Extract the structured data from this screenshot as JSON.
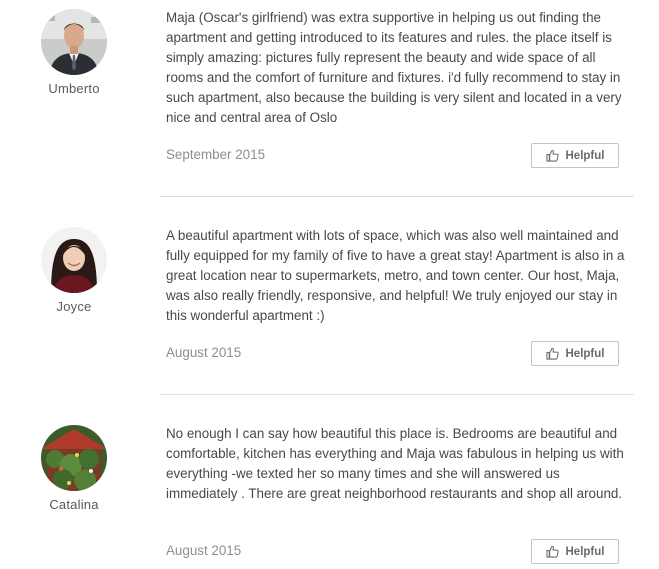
{
  "reviews": [
    {
      "reviewer": "Umberto",
      "text": "Maja (Oscar's girlfriend) was extra supportive in helping us out finding the apartment and getting introduced to its features and rules. the place itself is simply amazing: pictures fully represent the beauty and wide space of all rooms and the comfort of furniture and fixtures. i'd fully recommend to stay in such apartment, also because the building is very silent and located in a very nice and central area of Oslo",
      "date": "September 2015",
      "helpful_label": "Helpful"
    },
    {
      "reviewer": "Joyce",
      "text": "A beautiful apartment with lots of space, which was also well maintained and fully equipped for my family of five to have a great stay! Apartment is also in a great location near to supermarkets, metro, and town center. Our host, Maja, was also really friendly, responsive, and helpful! We truly enjoyed our stay in this wonderful apartment :)",
      "date": "August 2015",
      "helpful_label": "Helpful"
    },
    {
      "reviewer": "Catalina",
      "text": "No enough I can say how beautiful this place is. Bedrooms are beautiful and comfortable, kitchen has everything and Maja was fabulous in helping us with everything -we texted her so many times and she will answered us immediately . There are great neighborhood restaurants and shop all around.",
      "date": "August 2015",
      "helpful_label": "Helpful"
    }
  ],
  "colors": {
    "text": "#484848",
    "muted": "#8f8f8f",
    "divider": "#dce0e0",
    "button_border": "#c4c4c4"
  }
}
